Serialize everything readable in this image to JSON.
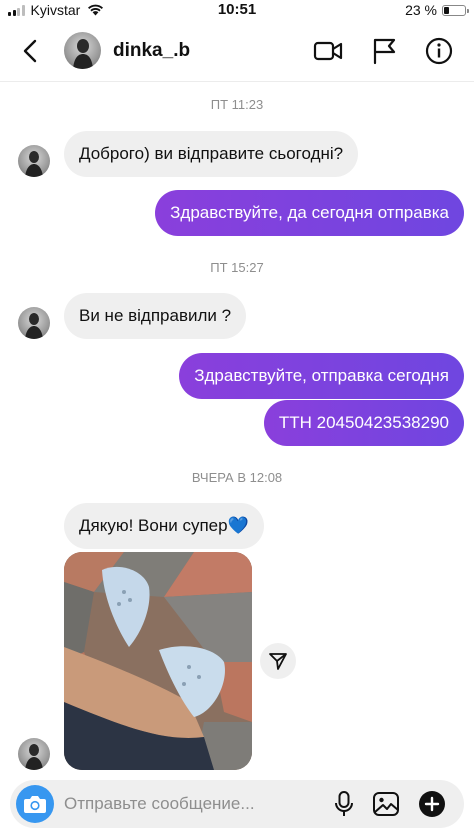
{
  "status": {
    "carrier": "Kyivstar",
    "time": "10:51",
    "battery_text": "23 %",
    "battery_level": 0.23
  },
  "header": {
    "username": "dinka_.b",
    "icons": [
      "back-icon",
      "video-camera-icon",
      "flag-icon",
      "info-icon"
    ]
  },
  "chat": {
    "timestamps": [
      "ПТ 11:23",
      "ПТ 15:27",
      "ВЧЕРА В 12:08"
    ],
    "messages": [
      {
        "direction": "in",
        "text": "Доброго) ви відправите сьогодні?"
      },
      {
        "direction": "out",
        "text": "Здравствуйте, да сегодня отправка"
      },
      {
        "direction": "in",
        "text": "Ви не відправили ?"
      },
      {
        "direction": "out",
        "text": "Здравствуйте, отправка сегодня"
      },
      {
        "direction": "out",
        "text": "ТТН 20450423538290"
      },
      {
        "direction": "in",
        "text": "Дякую! Вони супер💙"
      }
    ],
    "photo_description_icon": "shared-photo"
  },
  "composer": {
    "placeholder": "Отправьте сообщение...",
    "icons": [
      "camera-icon",
      "microphone-icon",
      "gallery-icon",
      "plus-icon"
    ]
  },
  "colors": {
    "outgoing_bubble": "#7c3ad8",
    "incoming_bubble": "#efefef",
    "camera_button": "#3797f0",
    "timestamp": "#8e8e8e"
  }
}
